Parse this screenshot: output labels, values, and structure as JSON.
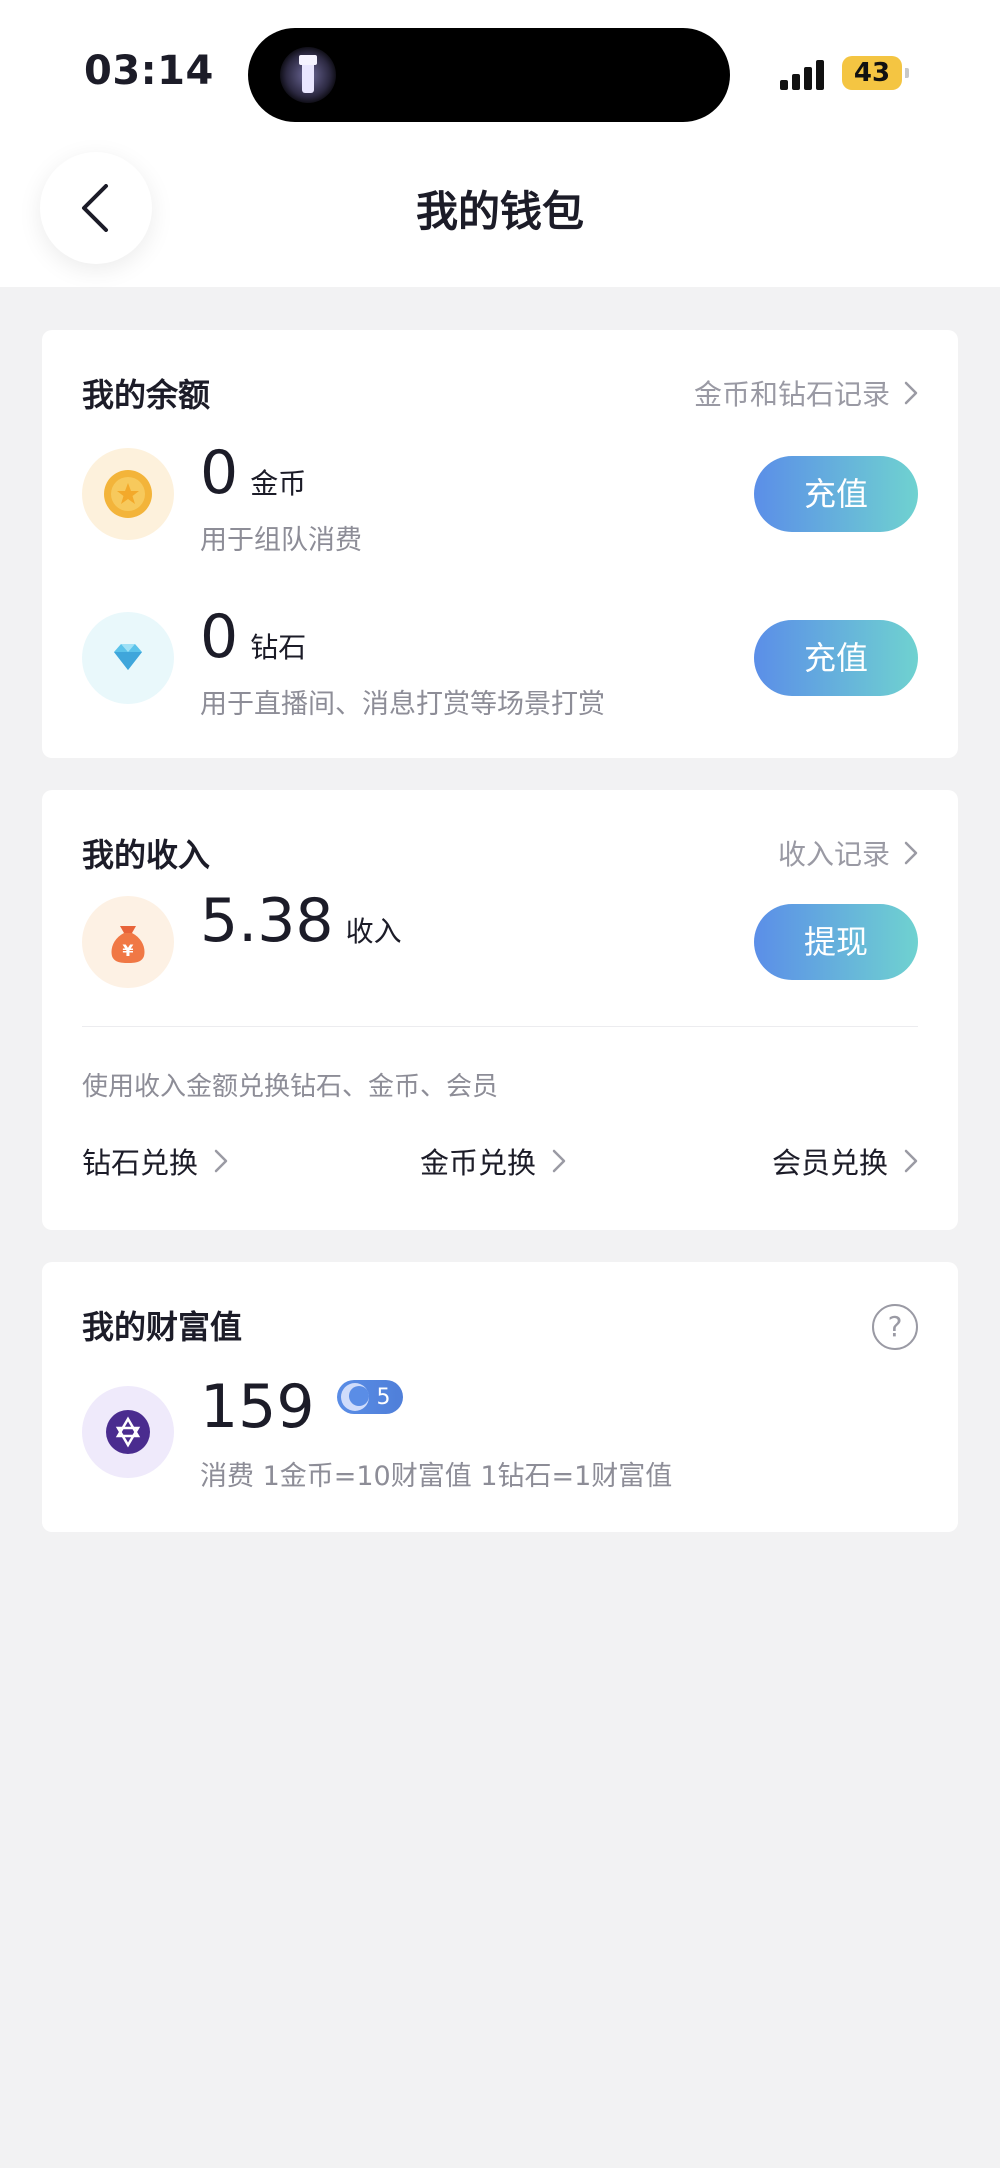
{
  "status_bar": {
    "time": "03:14",
    "battery": "43"
  },
  "header": {
    "title": "我的钱包"
  },
  "balance": {
    "title": "我的余额",
    "link": "金币和钻石记录",
    "coin": {
      "amount": "0",
      "unit": "金币",
      "desc": "用于组队消费",
      "button": "充值"
    },
    "diamond": {
      "amount": "0",
      "unit": "钻石",
      "desc": "用于直播间、消息打赏等场景打赏",
      "button": "充值"
    }
  },
  "income": {
    "title": "我的收入",
    "link": "收入记录",
    "amount": "5.38",
    "unit": "收入",
    "button": "提现",
    "hint": "使用收入金额兑换钻石、金币、会员",
    "exchanges": [
      "钻石兑换",
      "金币兑换",
      "会员兑换"
    ]
  },
  "wealth": {
    "title": "我的财富值",
    "help": "?",
    "amount": "159",
    "level": "5",
    "desc": "消费 1金币=10财富值 1钻石=1财富值"
  },
  "colors": {
    "accent_gradient_start": "#5b8ee8",
    "accent_gradient_end": "#6fd2d0",
    "background": "#f2f2f3"
  },
  "icons": [
    "back-icon",
    "coin-icon",
    "diamond-icon",
    "money-bag-icon",
    "star-of-david-icon",
    "moon-icon",
    "chevron-right-icon",
    "help-icon",
    "flashlight-icon"
  ]
}
